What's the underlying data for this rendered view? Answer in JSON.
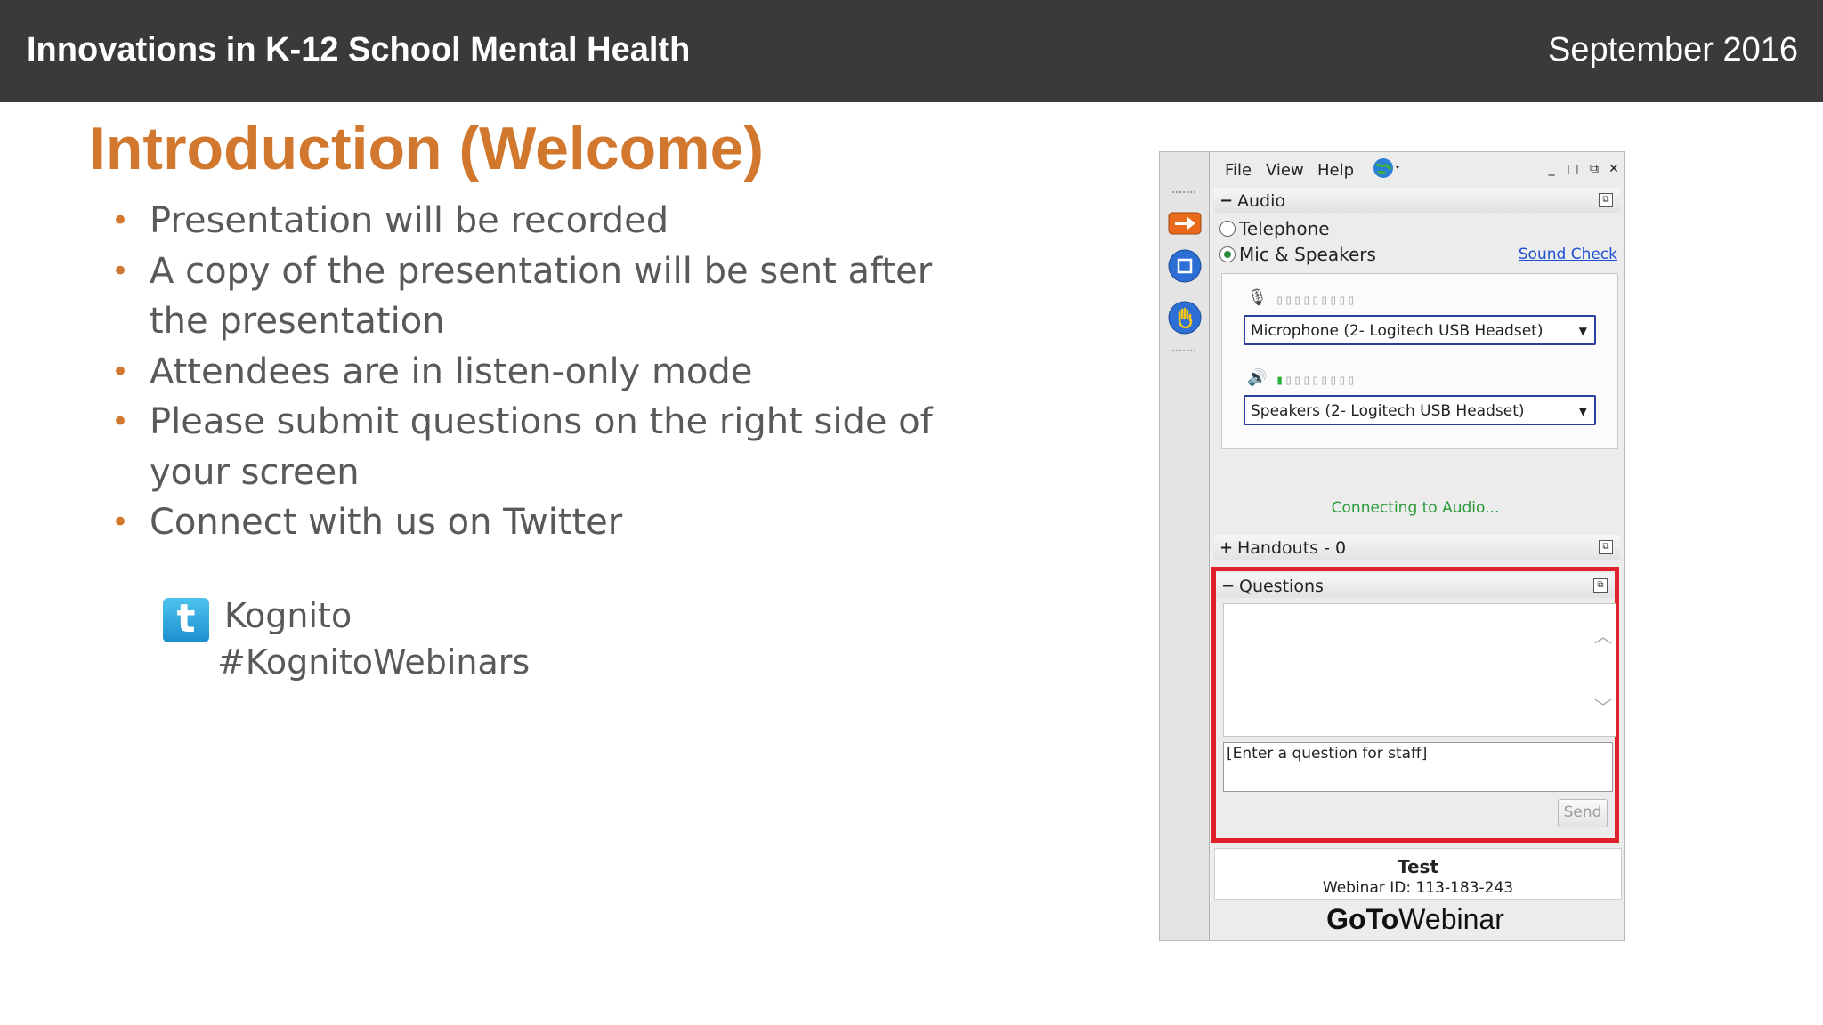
{
  "header": {
    "title": "Innovations in K-12 School Mental Health",
    "date": "September 2016"
  },
  "slide": {
    "title": "Introduction (Welcome)",
    "bullets": [
      "Presentation will be recorded",
      "A copy of the presentation will be sent after the presentation",
      "Attendees are in listen-only mode",
      "Please submit questions on the right side of your screen",
      "Connect with us on Twitter"
    ],
    "twitter": {
      "handle": "Kognito",
      "hashtag": "#KognitoWebinars"
    }
  },
  "gtw": {
    "menu": [
      "File",
      "View",
      "Help"
    ],
    "audio": {
      "header": "Audio",
      "option_telephone": "Telephone",
      "option_mic": "Mic & Speakers",
      "selected": "Mic & Speakers",
      "sound_check": "Sound Check",
      "mic_device": "Microphone (2- Logitech USB Headset)",
      "speaker_device": "Speakers (2- Logitech USB Headset)",
      "status": "Connecting to Audio..."
    },
    "handouts": {
      "header": "Handouts - 0"
    },
    "questions": {
      "header": "Questions",
      "input_placeholder": "[Enter a question for staff]",
      "send_label": "Send"
    },
    "footer": {
      "title": "Test",
      "webinar_id": "Webinar ID: 113-183-243",
      "brand_bold": "GoTo",
      "brand_light": "Webinar"
    },
    "colors": {
      "accent_orange": "#d2782e",
      "highlight_red": "#e0212b",
      "status_green": "#2a9a3a"
    }
  }
}
